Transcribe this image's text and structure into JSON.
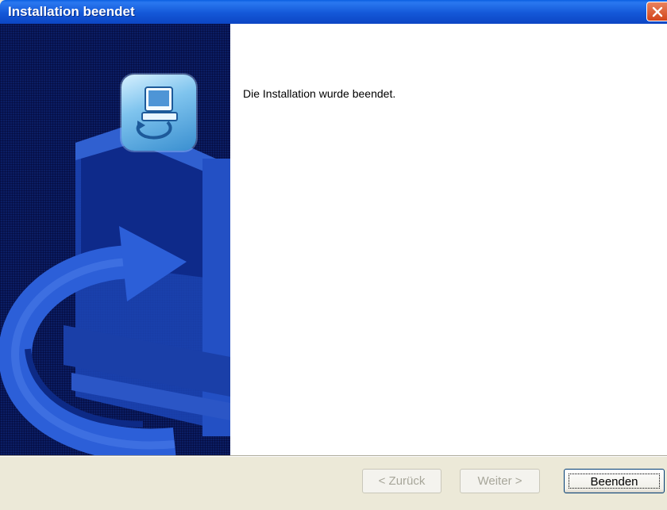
{
  "window": {
    "title": "Installation beendet",
    "close_icon": "close-icon"
  },
  "content": {
    "message": "Die Installation wurde beendet."
  },
  "sidepanel": {
    "icon": "setup-computer-icon"
  },
  "buttons": {
    "back_label": "< Zurück",
    "next_label": "Weiter >",
    "finish_label": "Beenden"
  },
  "colors": {
    "titlebar": "#0c46c4",
    "panel": "#0b1d63",
    "close": "#d3441a"
  }
}
